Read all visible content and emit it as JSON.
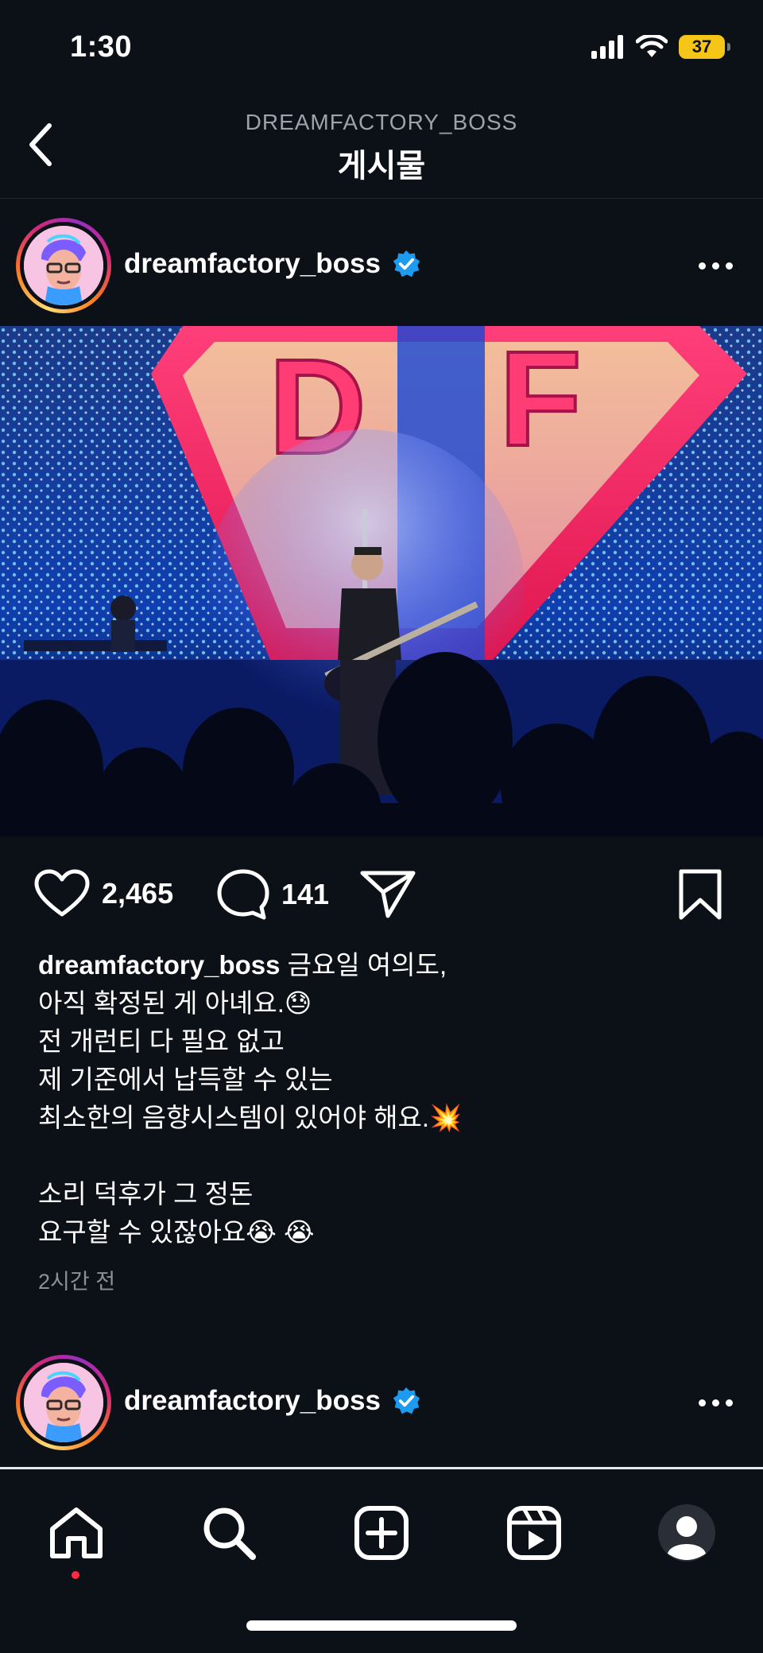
{
  "status_bar": {
    "time": "1:30",
    "battery": "37"
  },
  "header": {
    "account": "DREAMFACTORY_BOSS",
    "title": "게시물"
  },
  "post": {
    "username": "dreamfactory_boss",
    "verified": true,
    "image_logo_left": "D",
    "image_logo_right": "F",
    "likes": "2,465",
    "comments": "141",
    "caption_lines": [
      "금요일 여의도,",
      "아직 확정된 게 아녜요.😓",
      "전 개런티 다 필요 없고",
      "제 기준에서 납득할 수 있는",
      "최소한의 음향시스템이 있어야 해요.💥",
      "",
      "소리 덕후가 그 정돈",
      "요구할 수 있잖아요😭 😭"
    ],
    "timestamp": "2시간 전"
  },
  "next_post": {
    "username": "dreamfactory_boss",
    "verified": true
  },
  "bottom_nav": [
    "home",
    "search",
    "create",
    "reels",
    "profile"
  ],
  "colors": {
    "background": "#0c1017",
    "verified": "#1d9bf0",
    "notification": "#ff2a3d"
  }
}
